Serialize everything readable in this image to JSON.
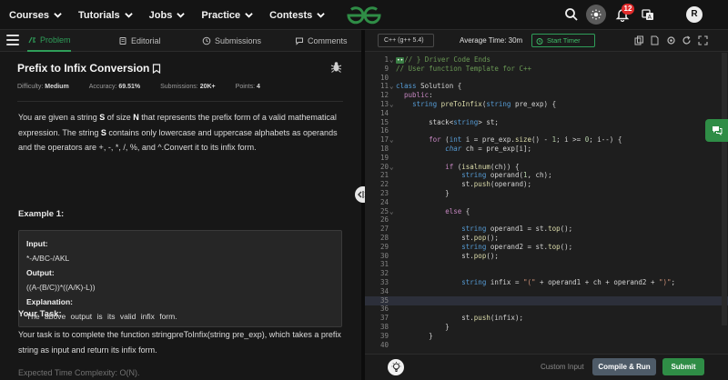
{
  "header": {
    "nav": [
      {
        "label": "Courses",
        "icon": "chevron-down-icon"
      },
      {
        "label": "Tutorials",
        "icon": "chevron-down-icon"
      },
      {
        "label": "Jobs",
        "icon": "chevron-down-icon"
      },
      {
        "label": "Practice",
        "icon": "chevron-down-icon"
      },
      {
        "label": "Contests",
        "icon": "chevron-down-icon"
      }
    ],
    "notification_count": "12",
    "avatar_letter": "R",
    "brand_color": "#2f8d46"
  },
  "problem": {
    "tabs": [
      {
        "label": "Problem",
        "icon": "problem-icon",
        "active": true
      },
      {
        "label": "Editorial",
        "icon": "book-icon"
      },
      {
        "label": "Submissions",
        "icon": "clock-icon"
      },
      {
        "label": "Comments",
        "icon": "comment-icon"
      }
    ],
    "title": "Prefix to Infix Conversion",
    "meta": {
      "difficulty_label": "Difficulty:",
      "difficulty": "Medium",
      "accuracy_label": "Accuracy:",
      "accuracy": "69.51%",
      "submissions_label": "Submissions:",
      "submissions": "20K+",
      "points_label": "Points:",
      "points": "4"
    },
    "desc_1": "You are given a string ",
    "desc_s1": "S",
    "desc_2": " of size ",
    "desc_n": "N",
    "desc_3": " that represents the prefix form of a valid mathematical expression. The string ",
    "desc_s2": "S",
    "desc_4": " contains only lowercase and uppercase alphabets as operands and the operators are +, -, *, /, %, and ^.Convert it to its infix form.",
    "example_heading": "Example 1:",
    "example": {
      "input_label": "Input:",
      "input_value": "*-A/BC-/AKL",
      "output_label": "Output:",
      "output_value": "((A-(B/C))*((A/K)-L))",
      "explanation_label": "Explanation:",
      "explanation_value": "The above output is its valid infix form."
    },
    "task_heading": "Your Task:",
    "task_text": "Your task is to complete the function stringpreToInfix(string pre_exp), which takes a prefix string as input and return its infix form.",
    "cut_text": "Expected Time Complexity: O(N)."
  },
  "editor": {
    "language": "C++ (g++ 5.4)",
    "avg_time": "Average Time: 30m",
    "timer_label": "Start Timer",
    "toolbar_icons": [
      "copy-icon",
      "file-icon",
      "settings-icon",
      "refresh-icon",
      "fullscreen-icon"
    ],
    "custom_input_label": "Custom Input",
    "compile_label": "Compile & Run",
    "submit_label": "Submit",
    "code_lines": [
      {
        "n": "1",
        "fold": "⌄",
        "html": "<span class='collapsed-box'>••</span><span class='c'>// } Driver Code Ends</span>"
      },
      {
        "n": "9",
        "fold": "",
        "html": "<span class='c'>// User function Template for C++</span>"
      },
      {
        "n": "10",
        "fold": "",
        "html": ""
      },
      {
        "n": "11",
        "fold": "⌄",
        "html": "<span class='t'>class</span> Solution {"
      },
      {
        "n": "12",
        "fold": "",
        "html": "  <span class='k'>public</span>:"
      },
      {
        "n": "13",
        "fold": "⌄",
        "html": "    <span class='t'>string</span> <span class='f'>preToInfix</span>(<span class='t'>string</span> pre_exp) {"
      },
      {
        "n": "14",
        "fold": "",
        "html": ""
      },
      {
        "n": "15",
        "fold": "",
        "html": "        stack<<span class='t'>string</span>> st;"
      },
      {
        "n": "16",
        "fold": "",
        "html": ""
      },
      {
        "n": "17",
        "fold": "⌄",
        "html": "        <span class='k'>for</span> (<span class='t'>int</span> i = pre_exp.<span class='f'>size</span>() - <span class='n'>1</span>; i >= <span class='n'>0</span>; i--) {"
      },
      {
        "n": "18",
        "fold": "",
        "html": "            <span class='t it'>char</span> ch = pre_exp[i];"
      },
      {
        "n": "19",
        "fold": "",
        "html": ""
      },
      {
        "n": "20",
        "fold": "⌄",
        "html": "            <span class='k'>if</span> (<span class='f'>isalnum</span>(ch)) {"
      },
      {
        "n": "21",
        "fold": "",
        "html": "                <span class='t'>string</span> operand(<span class='n'>1</span>, ch);"
      },
      {
        "n": "22",
        "fold": "",
        "html": "                st.<span class='f'>push</span>(operand);"
      },
      {
        "n": "23",
        "fold": "",
        "html": "            }"
      },
      {
        "n": "24",
        "fold": "",
        "html": ""
      },
      {
        "n": "25",
        "fold": "⌄",
        "html": "            <span class='k'>else</span> {"
      },
      {
        "n": "26",
        "fold": "",
        "html": ""
      },
      {
        "n": "27",
        "fold": "",
        "html": "                <span class='t'>string</span> operand1 = st.<span class='f'>top</span>();"
      },
      {
        "n": "28",
        "fold": "",
        "html": "                st.<span class='f'>pop</span>();"
      },
      {
        "n": "29",
        "fold": "",
        "html": "                <span class='t'>string</span> operand2 = st.<span class='f'>top</span>();"
      },
      {
        "n": "30",
        "fold": "",
        "html": "                st.<span class='f'>pop</span>();"
      },
      {
        "n": "31",
        "fold": "",
        "html": ""
      },
      {
        "n": "32",
        "fold": "",
        "html": ""
      },
      {
        "n": "33",
        "fold": "",
        "html": "                <span class='t'>string</span> infix = <span class='s'>\"(\"</span> + operand1 + ch + operand2 + <span class='s'>\")\"</span>;"
      },
      {
        "n": "34",
        "fold": "",
        "html": ""
      },
      {
        "n": "35",
        "fold": "",
        "html": "",
        "hl": true
      },
      {
        "n": "36",
        "fold": "",
        "html": ""
      },
      {
        "n": "37",
        "fold": "",
        "html": "                st.<span class='f'>push</span>(infix);"
      },
      {
        "n": "38",
        "fold": "",
        "html": "            }"
      },
      {
        "n": "39",
        "fold": "",
        "html": "        }"
      },
      {
        "n": "40",
        "fold": "",
        "html": ""
      }
    ]
  }
}
